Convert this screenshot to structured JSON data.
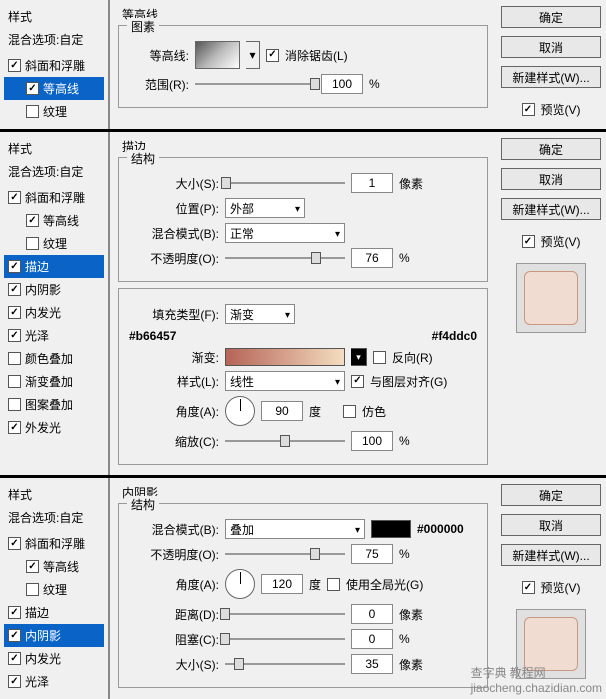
{
  "common": {
    "sidebar_title": "样式",
    "blend_options": "混合选项:自定",
    "ok": "确定",
    "cancel": "取消",
    "new_style": "新建样式(W)...",
    "preview": "预览(V)"
  },
  "styles": {
    "bevel": "斜面和浮雕",
    "contour": "等高线",
    "texture": "纹理",
    "stroke": "描边",
    "inner_shadow": "内阴影",
    "inner_glow": "内发光",
    "satin": "光泽",
    "color_overlay": "颜色叠加",
    "gradient_overlay": "渐变叠加",
    "pattern_overlay": "图案叠加",
    "outer_glow": "外发光"
  },
  "sec1": {
    "title": "等高线",
    "element": "图素",
    "contour_lbl": "等高线:",
    "antialias": "消除锯齿(L)",
    "range_lbl": "范围(R):",
    "range_val": "100",
    "pct": "%"
  },
  "sec2": {
    "title": "描边",
    "structure": "结构",
    "size_lbl": "大小(S):",
    "size_val": "1",
    "px": "像素",
    "position_lbl": "位置(P):",
    "position_val": "外部",
    "blend_lbl": "混合模式(B):",
    "blend_val": "正常",
    "opacity_lbl": "不透明度(O):",
    "opacity_val": "76",
    "pct": "%",
    "fill_type_lbl": "填充类型(F):",
    "fill_type_val": "渐变",
    "color1": "#b66457",
    "color2": "#f4ddc0",
    "gradient_lbl": "渐变:",
    "reverse": "反向(R)",
    "style_lbl": "样式(L):",
    "style_val": "线性",
    "align": "与图层对齐(G)",
    "angle_lbl": "角度(A):",
    "angle_val": "90",
    "deg": "度",
    "dither": "仿色",
    "scale_lbl": "缩放(C):",
    "scale_val": "100"
  },
  "sec3": {
    "title": "内阴影",
    "structure": "结构",
    "blend_lbl": "混合模式(B):",
    "blend_val": "叠加",
    "color": "#000000",
    "opacity_lbl": "不透明度(O):",
    "opacity_val": "75",
    "pct": "%",
    "angle_lbl": "角度(A):",
    "angle_val": "120",
    "deg": "度",
    "global": "使用全局光(G)",
    "distance_lbl": "距离(D):",
    "distance_val": "0",
    "px": "像素",
    "choke_lbl": "阻塞(C):",
    "choke_val": "0",
    "size_lbl": "大小(S):",
    "size_val": "35"
  },
  "watermark": {
    "brand": "查字典",
    "site": "教程网",
    "url": "jiaocheng.chazidian.com"
  }
}
